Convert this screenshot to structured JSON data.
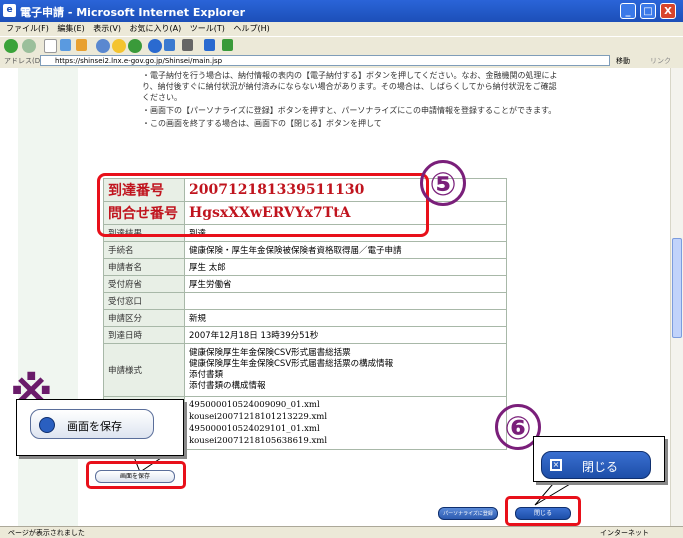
{
  "window": {
    "title": "電子申請 - Microsoft Internet Explorer",
    "controls": {
      "minimize": "_",
      "maximize": "□",
      "close": "X"
    }
  },
  "menu": [
    "ファイル(F)",
    "編集(E)",
    "表示(V)",
    "お気に入り(A)",
    "ツール(T)",
    "ヘルプ(H)"
  ],
  "address": {
    "label": "アドレス(D)",
    "url": "https://shinsei2.lnx.e-gov.go.jp/Shinsei/main.jsp",
    "go": "移動",
    "links": "リンク"
  },
  "instructions": [
    "・電子納付を行う場合は、納付情報の表内の【電子納付する】ボタンを押してください。なお、金融機関の処理により、納付後すぐに納付状況が納付済みにならない場合があります。その場合は、しばらくしてから納付状況をご確認ください。",
    "・画面下の【パーソナライズに登録】ボタンを押すと、パーソナライズにこの申請情報を登録することができます。",
    "・この画面を終了する場合は、画面下の【閉じる】ボタンを押して"
  ],
  "table": {
    "arrival_number_label": "到達番号",
    "arrival_number": "200712181339511130",
    "inquiry_number_label": "問合せ番号",
    "inquiry_number": "HgsxXXwERVYx7TtA",
    "rows": [
      {
        "key": "到達結果",
        "value": "到達"
      },
      {
        "key": "手続名",
        "value": "健康保険・厚生年金保険被保険者資格取得届／電子申請"
      },
      {
        "key": "申請者名",
        "value": "厚生 太郎"
      },
      {
        "key": "受付府省",
        "value": "厚生労働省"
      },
      {
        "key": "受付窓口",
        "value": ""
      },
      {
        "key": "申請区分",
        "value": "新規"
      },
      {
        "key": "到達日時",
        "value": "2007年12月18日 13時39分51秒"
      }
    ],
    "format_label": "申請様式",
    "format_lines": [
      "健康保険厚生年金保険CSV形式届書総括票",
      "健康保険厚生年金保険CSV形式届書総括票の構成情報",
      "添付書類",
      "添付書類の構成情報"
    ],
    "files": [
      "495000010524009090_01.xml",
      "kousei20071218101213229.xml",
      "495000010524029101_01.xml",
      "kousei20071218105638619.xml"
    ]
  },
  "annotations": {
    "step5": "⑤",
    "step6": "⑥",
    "asterisk": "※"
  },
  "buttons": {
    "save_screen": "画面を保存",
    "save_screen_small": "画面を保存",
    "close": "閉じる",
    "close_small": "閉じる",
    "personalize": "パーソナライズに登録"
  },
  "status": {
    "message": "ページが表示されました",
    "zone": "インターネット"
  },
  "colors": {
    "highlight_red": "#e8101a",
    "number_red": "#c0141e",
    "annotation_purple": "#7a1f7a",
    "button_blue": "#1d4ea8"
  }
}
